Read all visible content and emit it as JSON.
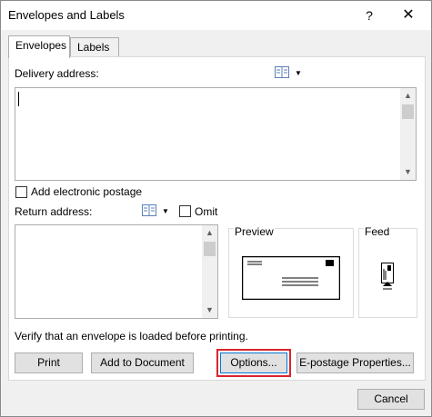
{
  "window": {
    "title": "Envelopes and Labels",
    "help_label": "?",
    "close_label": "✕"
  },
  "tabs": [
    {
      "label": "Envelopes",
      "active": true
    },
    {
      "label": "Labels",
      "active": false
    }
  ],
  "delivery": {
    "label": "Delivery address:",
    "value": ""
  },
  "postage": {
    "label": "Add electronic postage",
    "checked": false
  },
  "return_address": {
    "label": "Return address:",
    "value": "",
    "omit_label": "Omit",
    "omit_checked": false
  },
  "preview": {
    "label": "Preview"
  },
  "feed": {
    "label": "Feed"
  },
  "status_text": "Verify that an envelope is loaded before printing.",
  "buttons": {
    "print": "Print",
    "add_to_document": "Add to Document",
    "options": "Options...",
    "epostage": "E-postage Properties...",
    "cancel": "Cancel"
  },
  "icons": {
    "address_book": "address-book-icon",
    "dropdown": "dropdown-arrow-icon"
  }
}
